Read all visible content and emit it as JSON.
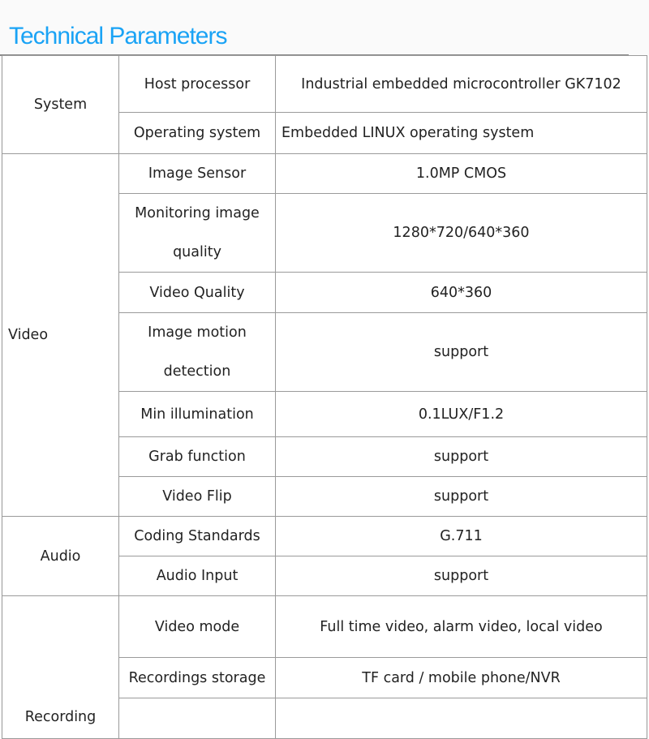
{
  "title": "Technical Parameters",
  "groups": [
    {
      "category": "System",
      "rows": [
        {
          "name": "Host processor",
          "value": "Industrial embedded microcontroller GK7102"
        },
        {
          "name": "Operating system",
          "value": "Embedded LINUX operating system"
        }
      ]
    },
    {
      "category": "Video",
      "rows": [
        {
          "name": "Image Sensor",
          "value": "1.0MP CMOS"
        },
        {
          "name_line1": "Monitoring image",
          "name_line2": "quality",
          "value": "1280*720/640*360"
        },
        {
          "name": "Video Quality",
          "value": "640*360"
        },
        {
          "name_line1": "Image motion",
          "name_line2": "detection",
          "value": "support"
        },
        {
          "name": "Min illumination",
          "value": "0.1LUX/F1.2"
        },
        {
          "name": "Grab function",
          "value": "support"
        },
        {
          "name": "Video Flip",
          "value": "support"
        }
      ]
    },
    {
      "category": "Audio",
      "rows": [
        {
          "name": "Coding Standards",
          "value": "G.711"
        },
        {
          "name": "Audio Input",
          "value": "support"
        }
      ]
    },
    {
      "category": "Recording",
      "rows": [
        {
          "name": "Video mode",
          "value": "Full time video, alarm video, local video"
        },
        {
          "name": "Recordings storage",
          "value": "TF card / mobile phone/NVR"
        },
        {
          "name": "",
          "value": ""
        }
      ]
    }
  ]
}
